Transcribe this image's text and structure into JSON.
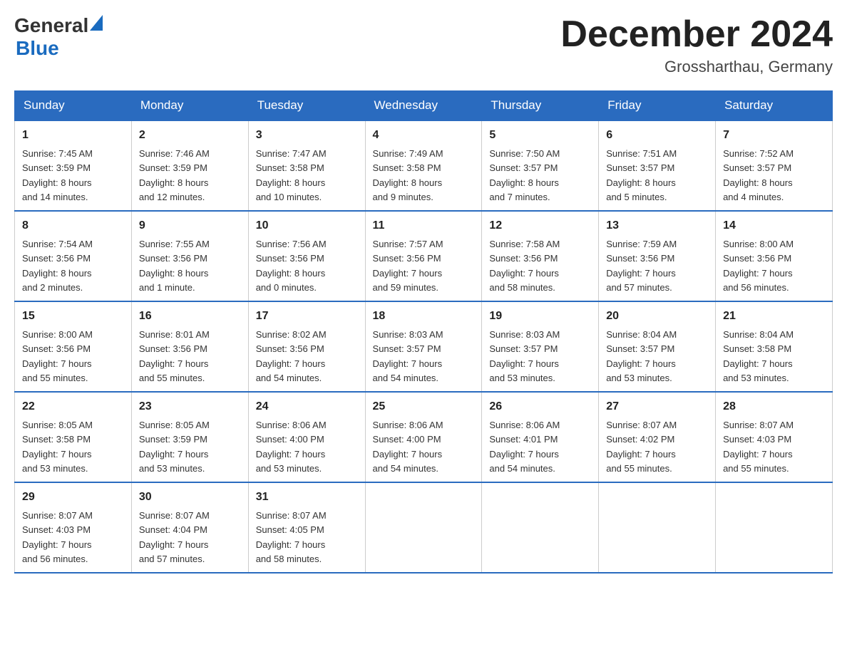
{
  "header": {
    "logo_general": "General",
    "logo_blue": "Blue",
    "month_year": "December 2024",
    "location": "Grossharthau, Germany"
  },
  "days_of_week": [
    "Sunday",
    "Monday",
    "Tuesday",
    "Wednesday",
    "Thursday",
    "Friday",
    "Saturday"
  ],
  "weeks": [
    [
      {
        "day": "1",
        "sunrise": "7:45 AM",
        "sunset": "3:59 PM",
        "daylight": "8 hours and 14 minutes."
      },
      {
        "day": "2",
        "sunrise": "7:46 AM",
        "sunset": "3:59 PM",
        "daylight": "8 hours and 12 minutes."
      },
      {
        "day": "3",
        "sunrise": "7:47 AM",
        "sunset": "3:58 PM",
        "daylight": "8 hours and 10 minutes."
      },
      {
        "day": "4",
        "sunrise": "7:49 AM",
        "sunset": "3:58 PM",
        "daylight": "8 hours and 9 minutes."
      },
      {
        "day": "5",
        "sunrise": "7:50 AM",
        "sunset": "3:57 PM",
        "daylight": "8 hours and 7 minutes."
      },
      {
        "day": "6",
        "sunrise": "7:51 AM",
        "sunset": "3:57 PM",
        "daylight": "8 hours and 5 minutes."
      },
      {
        "day": "7",
        "sunrise": "7:52 AM",
        "sunset": "3:57 PM",
        "daylight": "8 hours and 4 minutes."
      }
    ],
    [
      {
        "day": "8",
        "sunrise": "7:54 AM",
        "sunset": "3:56 PM",
        "daylight": "8 hours and 2 minutes."
      },
      {
        "day": "9",
        "sunrise": "7:55 AM",
        "sunset": "3:56 PM",
        "daylight": "8 hours and 1 minute."
      },
      {
        "day": "10",
        "sunrise": "7:56 AM",
        "sunset": "3:56 PM",
        "daylight": "8 hours and 0 minutes."
      },
      {
        "day": "11",
        "sunrise": "7:57 AM",
        "sunset": "3:56 PM",
        "daylight": "7 hours and 59 minutes."
      },
      {
        "day": "12",
        "sunrise": "7:58 AM",
        "sunset": "3:56 PM",
        "daylight": "7 hours and 58 minutes."
      },
      {
        "day": "13",
        "sunrise": "7:59 AM",
        "sunset": "3:56 PM",
        "daylight": "7 hours and 57 minutes."
      },
      {
        "day": "14",
        "sunrise": "8:00 AM",
        "sunset": "3:56 PM",
        "daylight": "7 hours and 56 minutes."
      }
    ],
    [
      {
        "day": "15",
        "sunrise": "8:00 AM",
        "sunset": "3:56 PM",
        "daylight": "7 hours and 55 minutes."
      },
      {
        "day": "16",
        "sunrise": "8:01 AM",
        "sunset": "3:56 PM",
        "daylight": "7 hours and 55 minutes."
      },
      {
        "day": "17",
        "sunrise": "8:02 AM",
        "sunset": "3:56 PM",
        "daylight": "7 hours and 54 minutes."
      },
      {
        "day": "18",
        "sunrise": "8:03 AM",
        "sunset": "3:57 PM",
        "daylight": "7 hours and 54 minutes."
      },
      {
        "day": "19",
        "sunrise": "8:03 AM",
        "sunset": "3:57 PM",
        "daylight": "7 hours and 53 minutes."
      },
      {
        "day": "20",
        "sunrise": "8:04 AM",
        "sunset": "3:57 PM",
        "daylight": "7 hours and 53 minutes."
      },
      {
        "day": "21",
        "sunrise": "8:04 AM",
        "sunset": "3:58 PM",
        "daylight": "7 hours and 53 minutes."
      }
    ],
    [
      {
        "day": "22",
        "sunrise": "8:05 AM",
        "sunset": "3:58 PM",
        "daylight": "7 hours and 53 minutes."
      },
      {
        "day": "23",
        "sunrise": "8:05 AM",
        "sunset": "3:59 PM",
        "daylight": "7 hours and 53 minutes."
      },
      {
        "day": "24",
        "sunrise": "8:06 AM",
        "sunset": "4:00 PM",
        "daylight": "7 hours and 53 minutes."
      },
      {
        "day": "25",
        "sunrise": "8:06 AM",
        "sunset": "4:00 PM",
        "daylight": "7 hours and 54 minutes."
      },
      {
        "day": "26",
        "sunrise": "8:06 AM",
        "sunset": "4:01 PM",
        "daylight": "7 hours and 54 minutes."
      },
      {
        "day": "27",
        "sunrise": "8:07 AM",
        "sunset": "4:02 PM",
        "daylight": "7 hours and 55 minutes."
      },
      {
        "day": "28",
        "sunrise": "8:07 AM",
        "sunset": "4:03 PM",
        "daylight": "7 hours and 55 minutes."
      }
    ],
    [
      {
        "day": "29",
        "sunrise": "8:07 AM",
        "sunset": "4:03 PM",
        "daylight": "7 hours and 56 minutes."
      },
      {
        "day": "30",
        "sunrise": "8:07 AM",
        "sunset": "4:04 PM",
        "daylight": "7 hours and 57 minutes."
      },
      {
        "day": "31",
        "sunrise": "8:07 AM",
        "sunset": "4:05 PM",
        "daylight": "7 hours and 58 minutes."
      },
      null,
      null,
      null,
      null
    ]
  ],
  "labels": {
    "sunrise": "Sunrise:",
    "sunset": "Sunset:",
    "daylight": "Daylight:"
  }
}
